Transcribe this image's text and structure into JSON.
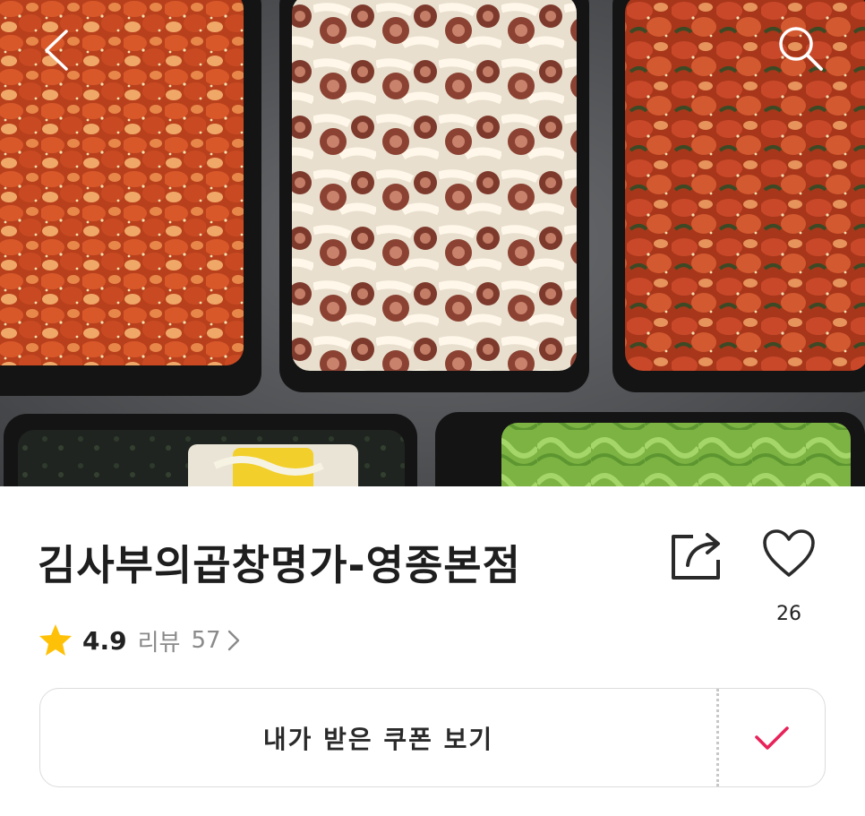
{
  "header": {
    "back_icon": "chevron-left-icon",
    "search_icon": "search-icon"
  },
  "store": {
    "name": "김사부의곱창명가-영종본점",
    "like_count": "26",
    "share_icon": "share-icon",
    "like_icon": "heart-outline-icon"
  },
  "rating": {
    "value": "4.9",
    "review_label": "리뷰",
    "review_count": "57",
    "star_icon": "star-icon",
    "star_color": "#ffc107"
  },
  "coupon": {
    "label": "내가 받은 쿠폰 보기",
    "check_icon": "check-icon",
    "check_color": "#e8235a"
  }
}
